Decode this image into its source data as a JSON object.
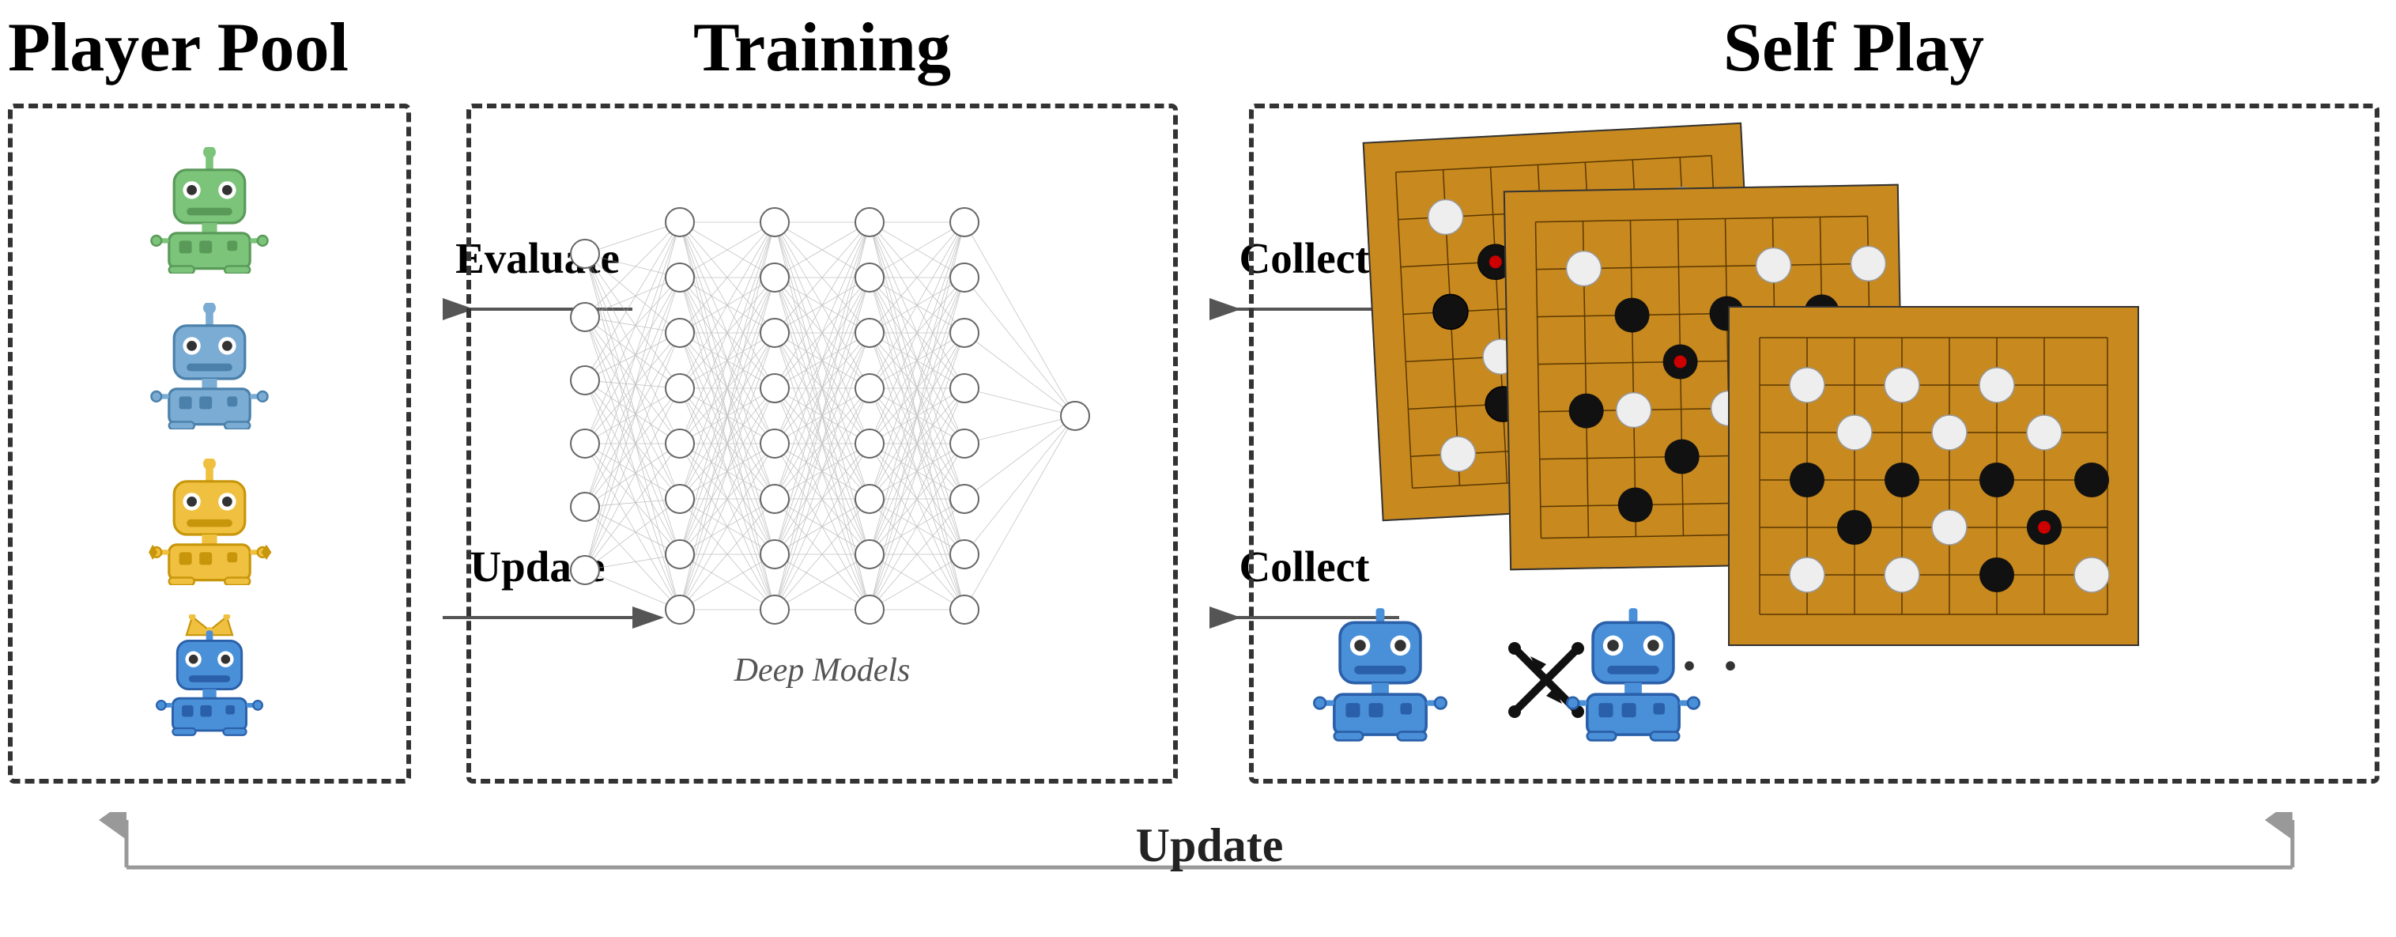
{
  "playerPool": {
    "title": "Player Pool",
    "robots": [
      {
        "color": "#7bc47a",
        "crown": false,
        "id": "green-robot"
      },
      {
        "color": "#7bacd4",
        "crown": false,
        "id": "blue-robot-1"
      },
      {
        "color": "#f0c040",
        "crown": false,
        "id": "yellow-robot"
      },
      {
        "color": "#4a90d9",
        "crown": true,
        "id": "blue-robot-crown"
      }
    ]
  },
  "training": {
    "title": "Training",
    "deepModelsLabel": "Deep Models"
  },
  "selfPlay": {
    "title": "Self Play"
  },
  "arrows": {
    "evaluate": "Evaluate",
    "update": "Update",
    "collect1": "Collect",
    "collect2": "Collect",
    "bottomUpdate": "Update"
  },
  "colors": {
    "background": "#ffffff",
    "border": "#333333",
    "arrow": "#666666",
    "boardColor": "#c8891e",
    "greenRobot": "#7bc47a",
    "blueRobot": "#7bacd4",
    "yellowRobot": "#f0c040",
    "blueRobotCrown": "#4a90d9"
  }
}
